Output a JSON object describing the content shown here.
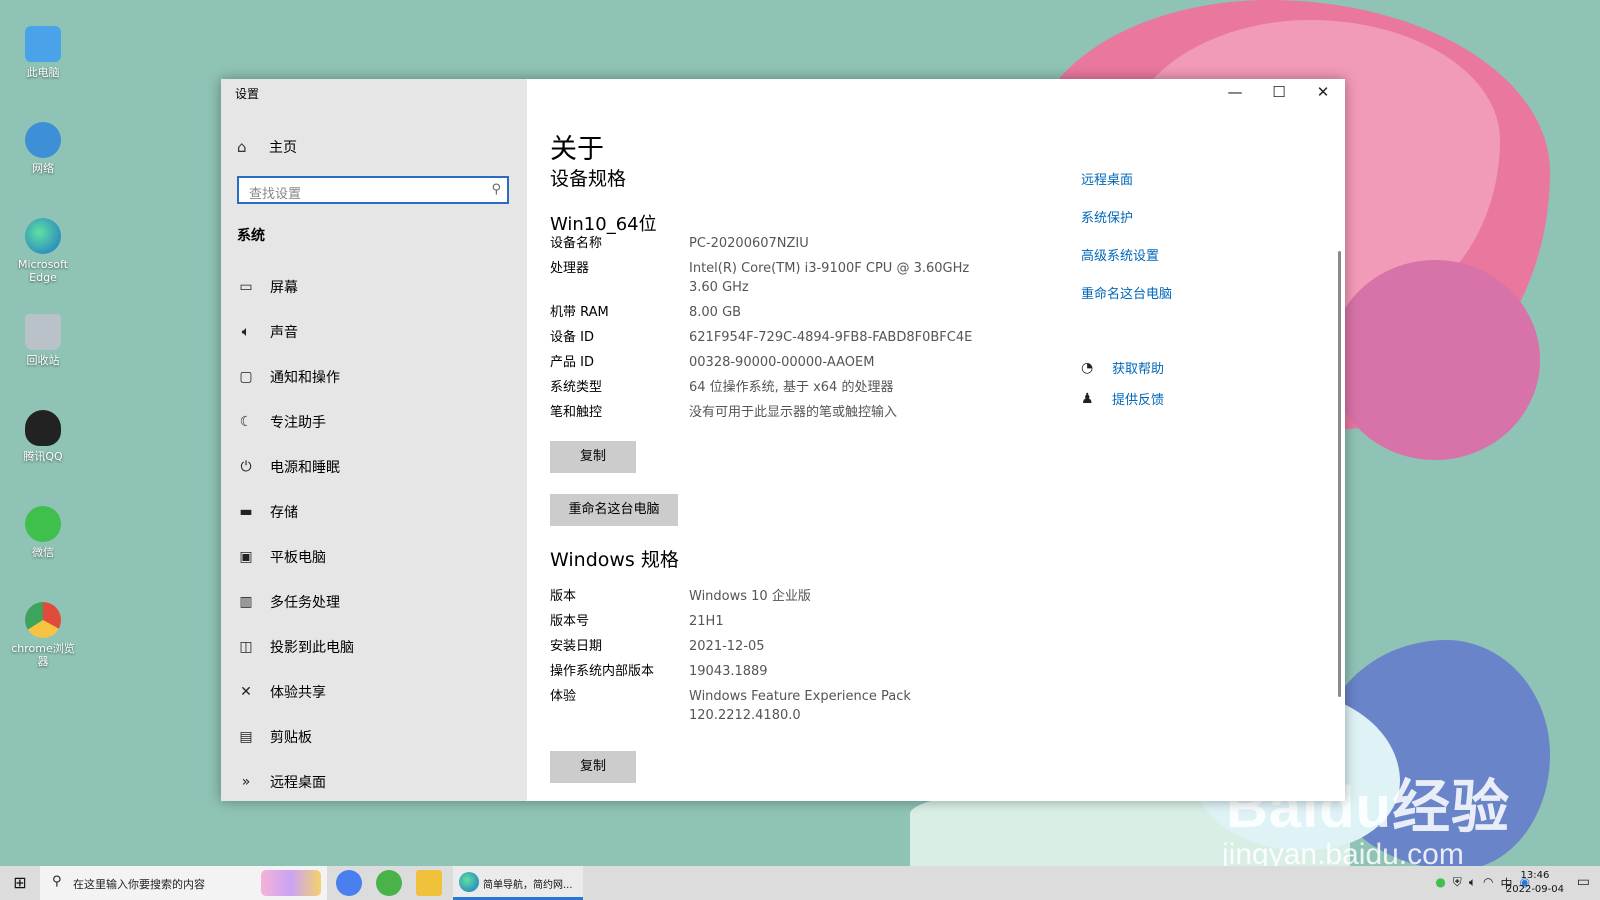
{
  "desktop": {
    "icons": [
      {
        "label": "此电脑",
        "color": "#4aa3e8"
      },
      {
        "label": "网络",
        "color": "#3d8fd6"
      },
      {
        "label": "Microsoft Edge",
        "color": "#1b8fd1"
      },
      {
        "label": "回收站",
        "color": "#b8c2c8"
      },
      {
        "label": "腾讯QQ",
        "color": "#222222"
      },
      {
        "label": "微信",
        "color": "#3fbf4b"
      },
      {
        "label": "chrome浏览器",
        "color": "#e14b3b"
      }
    ],
    "watermark_main": "Baidu经验",
    "watermark_sub": "jingyan.baidu.com"
  },
  "window": {
    "app_title": "设置",
    "controls": {
      "minimize": "—",
      "maximize": "☐",
      "close": "✕"
    },
    "sidebar": {
      "home": "主页",
      "search_placeholder": "查找设置",
      "category": "系统",
      "items": [
        {
          "label": "屏幕",
          "icon": "monitor-icon"
        },
        {
          "label": "声音",
          "icon": "speaker-icon"
        },
        {
          "label": "通知和操作",
          "icon": "notification-icon"
        },
        {
          "label": "专注助手",
          "icon": "moon-icon"
        },
        {
          "label": "电源和睡眠",
          "icon": "power-icon"
        },
        {
          "label": "存储",
          "icon": "storage-icon"
        },
        {
          "label": "平板电脑",
          "icon": "tablet-icon"
        },
        {
          "label": "多任务处理",
          "icon": "multitask-icon"
        },
        {
          "label": "投影到此电脑",
          "icon": "project-icon"
        },
        {
          "label": "体验共享",
          "icon": "share-icon"
        },
        {
          "label": "剪贴板",
          "icon": "clipboard-icon"
        },
        {
          "label": "远程桌面",
          "icon": "remote-icon"
        }
      ]
    },
    "content": {
      "page_title": "关于",
      "device_spec_title": "设备规格",
      "device_name": "Win10_64位",
      "device_specs": [
        {
          "key": "设备名称",
          "value": "PC-20200607NZIU"
        },
        {
          "key": "处理器",
          "value": "Intel(R) Core(TM) i3-9100F CPU @ 3.60GHz",
          "value2": "3.60 GHz"
        },
        {
          "key": "机带 RAM",
          "value": "8.00 GB"
        },
        {
          "key": "设备 ID",
          "value": "621F954F-729C-4894-9FB8-FABD8F0BFC4E"
        },
        {
          "key": "产品 ID",
          "value": "00328-90000-00000-AAOEM"
        },
        {
          "key": "系统类型",
          "value": "64 位操作系统, 基于 x64 的处理器"
        },
        {
          "key": "笔和触控",
          "value": "没有可用于此显示器的笔或触控输入"
        }
      ],
      "copy_button": "复制",
      "rename_button": "重命名这台电脑",
      "windows_spec_title": "Windows 规格",
      "windows_specs": [
        {
          "key": "版本",
          "value": "Windows 10 企业版"
        },
        {
          "key": "版本号",
          "value": "21H1"
        },
        {
          "key": "安装日期",
          "value": "2021-12-05"
        },
        {
          "key": "操作系统内部版本",
          "value": "19043.1889"
        },
        {
          "key": "体验",
          "value": "Windows Feature Experience Pack",
          "value2": "120.2212.4180.0"
        }
      ],
      "copy_button_2": "复制",
      "related_links": [
        "远程桌面",
        "系统保护",
        "高级系统设置",
        "重命名这台电脑"
      ],
      "help_links": [
        {
          "label": "获取帮助",
          "icon": "help-chat-icon"
        },
        {
          "label": "提供反馈",
          "icon": "feedback-icon"
        }
      ]
    }
  },
  "taskbar": {
    "search_placeholder": "在这里输入你要搜索的内容",
    "active_app_title": "简单导航，简约网...",
    "time": "13:46",
    "date": "2022-09-04"
  }
}
